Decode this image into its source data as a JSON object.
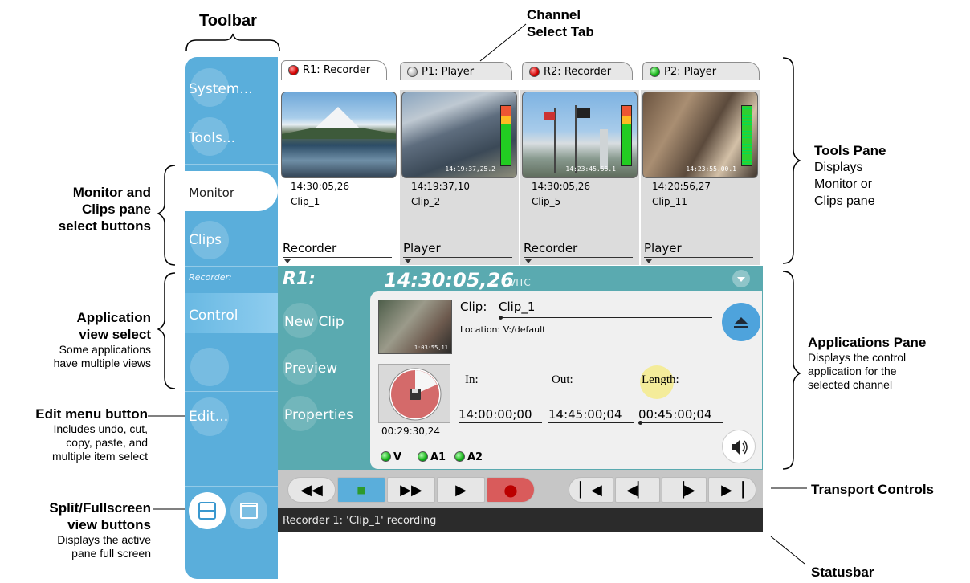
{
  "annotations": {
    "toolbar": "Toolbar",
    "channel_select_line1": "Channel",
    "channel_select_line2": "Select Tab",
    "tools_pane_title": "Tools Pane",
    "tools_pane_desc": [
      "Displays",
      "Monitor or",
      "Clips pane"
    ],
    "monitor_clips_line1": "Monitor  and",
    "monitor_clips_line2": "Clips pane",
    "monitor_clips_line3": "select buttons",
    "app_view_line1": "Application",
    "app_view_line2": "view select",
    "app_view_desc": [
      "Some applications",
      "have multiple views"
    ],
    "apps_pane_title": "Applications Pane",
    "apps_pane_desc": [
      "Displays the control",
      "application for the",
      "selected channel"
    ],
    "edit_menu_title": "Edit menu button",
    "edit_menu_desc": [
      "Includes undo, cut,",
      "copy, paste, and",
      "multiple item select"
    ],
    "split_line1": "Split/Fullscreen",
    "split_line2": "view buttons",
    "split_desc": [
      "Displays the active",
      "pane full screen"
    ],
    "transport_controls": "Transport Controls",
    "statusbar": "Statusbar"
  },
  "toolbar": {
    "system": "System...",
    "tools": "Tools...",
    "monitor": "Monitor",
    "clips": "Clips",
    "recorder_label": "Recorder:",
    "control": "Control",
    "edit": "Edit..."
  },
  "tabs": [
    {
      "label": "R1: Recorder",
      "led": "red"
    },
    {
      "label": "P1: Player",
      "led": "gray"
    },
    {
      "label": "R2: Recorder",
      "led": "red"
    },
    {
      "label": "P2: Player",
      "led": "green"
    }
  ],
  "monitors": [
    {
      "timecode": "14:30:05,26",
      "clip": "Clip_1",
      "mode": "Recorder"
    },
    {
      "timecode": "14:19:37,10",
      "clip": "Clip_2",
      "mode": "Player",
      "overlay": "14:19:37,25.2"
    },
    {
      "timecode": "14:30:05,26",
      "clip": "Clip_5",
      "mode": "Recorder",
      "overlay": "14:23:45.56.1"
    },
    {
      "timecode": "14:20:56,27",
      "clip": "Clip_11",
      "mode": "Player",
      "overlay": "14:23:55.00.1"
    }
  ],
  "app": {
    "channel": "R1:",
    "timecode": "14:30:05,26",
    "tc_type": "VITC",
    "side_new_clip": "New Clip",
    "side_preview": "Preview",
    "side_properties": "Properties",
    "clip_label": "Clip:",
    "clip_name": "Clip_1",
    "location": "Location:  V:/default",
    "in_label": "In:",
    "out_label": "Out:",
    "length_label": "Length:",
    "in_value": "14:00:00;00",
    "out_value": "14:45:00;04",
    "length_value": "00:45:00;04",
    "record_time": "00:29:30,24",
    "thumb_overlay": "1:03:55,11",
    "tracks": [
      "V",
      "A1",
      "A2"
    ]
  },
  "status": {
    "text": "Recorder 1: 'Clip_1'  recording"
  },
  "colors": {
    "toolbar_blue": "#5aaedb",
    "app_teal": "#5aaab0",
    "record_red": "#d95b5b"
  }
}
